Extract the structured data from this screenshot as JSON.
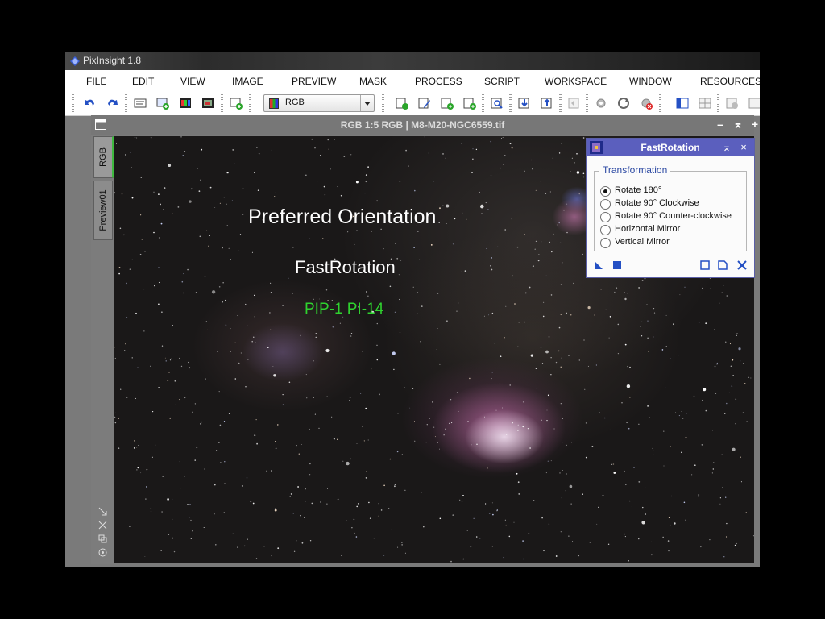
{
  "app": {
    "title": "PixInsight 1.8"
  },
  "menu": [
    "FILE",
    "EDIT",
    "VIEW",
    "IMAGE",
    "PREVIEW",
    "MASK",
    "PROCESS",
    "SCRIPT",
    "WORKSPACE",
    "WINDOW",
    "RESOURCES"
  ],
  "toolbar": {
    "view_selector": {
      "selected": "RGB"
    },
    "icons": [
      "undo-icon",
      "redo-icon",
      "image-properties-icon",
      "new-image-icon",
      "channel-display-icon",
      "rgb-display-icon",
      "new-preview-icon"
    ]
  },
  "image_window": {
    "title": "RGB 1:5 RGB | M8-M20-NGC6559.tif",
    "tabs": [
      "RGB",
      "Preview01"
    ]
  },
  "overlay": {
    "title": "Preferred Orientation",
    "subtitle": "FastRotation",
    "tag": "PIP-1 PI-14"
  },
  "colors": {
    "dialog_accent": "#5b5fbe",
    "overlay_tag": "#2fd22f"
  },
  "dialog": {
    "title": "FastRotation",
    "group": "Transformation",
    "options": [
      "Rotate 180°",
      "Rotate 90° Clockwise",
      "Rotate 90° Counter-clockwise",
      "Horizontal Mirror",
      "Vertical Mirror"
    ],
    "selected": "Rotate 180°"
  }
}
